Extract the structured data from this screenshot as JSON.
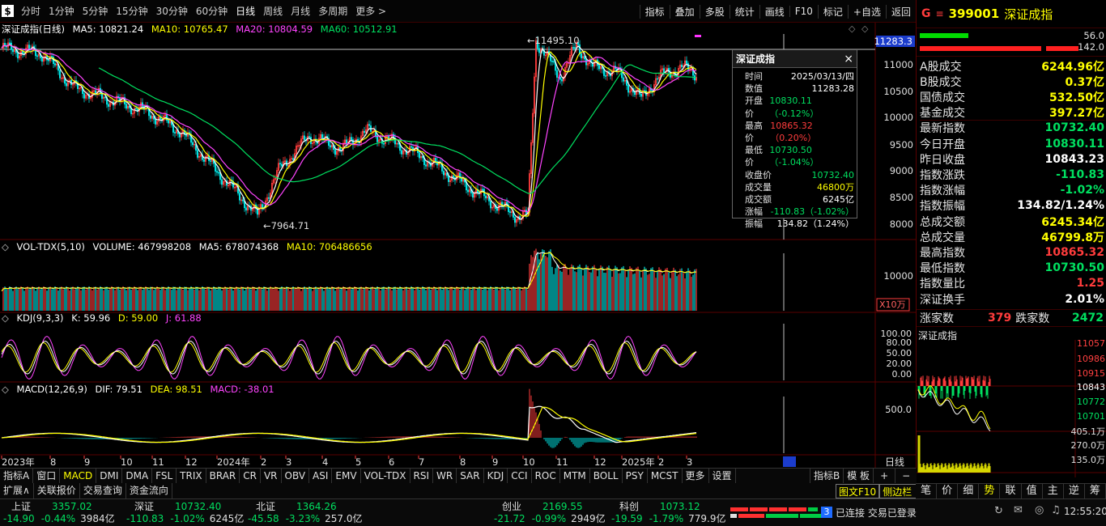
{
  "toolbar": {
    "logo": "$",
    "periods": [
      "分时",
      "1分钟",
      "5分钟",
      "15分钟",
      "30分钟",
      "60分钟",
      "日线",
      "周线",
      "月线",
      "多周期",
      "更多 >"
    ],
    "active_period": "日线",
    "right_items": [
      "指标",
      "叠加",
      "多股",
      "统计",
      "画线",
      "F10",
      "标记",
      "+自选",
      "返回"
    ]
  },
  "stock": {
    "g_label": "G",
    "menu": "≡",
    "code": "399001",
    "name": "深证成指"
  },
  "main_legend": {
    "title": "深证成指(日线)",
    "ma5": "MA5: 10821.24",
    "ma10": "MA10: 10765.47",
    "ma20": "MA20: 10804.59",
    "ma60": "MA60: 10512.91"
  },
  "price_axis": [
    "11000",
    "10500",
    "10000",
    "9500",
    "9000",
    "8500",
    "8000"
  ],
  "current_price_tag": "11283.3",
  "high_label": "11495.10",
  "low_label": "7964.71",
  "popup": {
    "title": "深证成指",
    "close": "×",
    "rows": [
      {
        "k": "时间",
        "v": "2025/03/13/四",
        "c": "white"
      },
      {
        "k": "数值",
        "v": "11283.28",
        "c": "white"
      },
      {
        "k": "开盘价",
        "v": "10830.11（-0.12%）",
        "c": "green"
      },
      {
        "k": "最高价",
        "v": "10865.32（0.20%）",
        "c": "red"
      },
      {
        "k": "最低价",
        "v": "10730.50（-1.04%）",
        "c": "green"
      },
      {
        "k": "收盘价",
        "v": "10732.40",
        "c": "green"
      },
      {
        "k": "成交量",
        "v": "46800万",
        "c": "yellow"
      },
      {
        "k": "成交额",
        "v": "6245亿",
        "c": "white"
      },
      {
        "k": "涨幅",
        "v": "-110.83（-1.02%）",
        "c": "green"
      },
      {
        "k": "振幅",
        "v": "134.82（1.24%）",
        "c": "white"
      }
    ]
  },
  "vol_legend": {
    "title": "VOL-TDX(5,10)",
    "volume": "VOLUME: 467998208",
    "ma5": "MA5: 678074368",
    "ma10": "MA10: 706486656"
  },
  "vol_axis": "10000",
  "vol_unit": "X10万",
  "kdj_legend": {
    "title": "KDJ(9,3,3)",
    "k": "K: 59.96",
    "d": "D: 59.00",
    "j": "J: 61.88"
  },
  "kdj_axis": [
    "100.00",
    "80.00",
    "50.00",
    "20.00",
    "0.00"
  ],
  "macd_legend": {
    "title": "MACD(12,26,9)",
    "dif": "DIF: 79.51",
    "dea": "DEA: 98.51",
    "macd": "MACD: -38.01"
  },
  "macd_axis": "500.0",
  "date_axis": [
    "2023年",
    "8",
    "9",
    "10",
    "11",
    "12",
    "2024年",
    "2",
    "3",
    "4",
    "5",
    "6",
    "7",
    "8",
    "9",
    "10",
    "11",
    "12",
    "2025年",
    "2",
    "3"
  ],
  "date_axis_right": "日线",
  "right_stats_top": {
    "up_count": "56.0",
    "down_count": "142.0",
    "up_color": "#00dd00",
    "down_color": "#ff2020"
  },
  "right_stats": [
    {
      "k": "A股成交",
      "v": "6244.96亿",
      "c": "yellow"
    },
    {
      "k": "B股成交",
      "v": "0.37亿",
      "c": "yellow"
    },
    {
      "k": "国债成交",
      "v": "532.50亿",
      "c": "yellow"
    },
    {
      "k": "基金成交",
      "v": "397.27亿",
      "c": "yellow"
    },
    {
      "k": "最新指数",
      "v": "10732.40",
      "c": "green"
    },
    {
      "k": "今日开盘",
      "v": "10830.11",
      "c": "green"
    },
    {
      "k": "昨日收盘",
      "v": "10843.23",
      "c": "white"
    },
    {
      "k": "指数涨跌",
      "v": "-110.83",
      "c": "green"
    },
    {
      "k": "指数涨幅",
      "v": "-1.02%",
      "c": "green"
    },
    {
      "k": "指数振幅",
      "v": "134.82/1.24%",
      "c": "white"
    },
    {
      "k": "总成交额",
      "v": "6245.34亿",
      "c": "yellow"
    },
    {
      "k": "总成交量",
      "v": "46799.8万",
      "c": "yellow"
    },
    {
      "k": "最高指数",
      "v": "10865.32",
      "c": "red"
    },
    {
      "k": "最低指数",
      "v": "10730.50",
      "c": "green"
    },
    {
      "k": "指数量比",
      "v": "1.25",
      "c": "red"
    },
    {
      "k": "深证换手",
      "v": "2.01%",
      "c": "white"
    }
  ],
  "breadth": {
    "up_label": "涨家数",
    "up": "379",
    "down_label": "跌家数",
    "down": "2472"
  },
  "mini_chart": {
    "title": "深证成指",
    "axis": [
      "11057",
      "10986",
      "10915",
      "10843",
      "10772",
      "10701",
      "405.1万",
      "270.0万",
      "135.0万"
    ]
  },
  "bottom_tabs": [
    "指标A",
    "窗口",
    "MACD",
    "DMI",
    "DMA",
    "FSL",
    "TRIX",
    "BRAR",
    "CR",
    "VR",
    "OBV",
    "ASI",
    "EMV",
    "VOL-TDX",
    "RSI",
    "WR",
    "SAR",
    "KDJ",
    "CCI",
    "ROC",
    "MTM",
    "BOLL",
    "PSY",
    "MCST",
    "更多",
    "设置"
  ],
  "bottom_tabs_selected": "MACD",
  "bottom_tabs_right": [
    "指标B",
    "模 板",
    "+",
    "−"
  ],
  "second_tabs": [
    "扩展∧",
    "关联报价",
    "交易查询",
    "资金流向"
  ],
  "second_tabs_right": [
    "图文F10",
    "侧边栏《"
  ],
  "right_tabs": [
    "笔",
    "价",
    "细",
    "势",
    "联",
    "值",
    "主",
    "逆",
    "筹"
  ],
  "right_tabs_selected": "势",
  "status": {
    "indices": [
      {
        "name": "上证",
        "value": "3357.02",
        "chg": "-14.90",
        "pct": "-0.44%",
        "amt": "3984亿"
      },
      {
        "name": "深证",
        "value": "10732.40",
        "chg": "-110.83",
        "pct": "-1.02%",
        "amt": "6245亿"
      },
      {
        "name": "北证",
        "value": "1364.26",
        "chg": "-45.58",
        "pct": "-3.23%",
        "amt": "257.0亿"
      },
      {
        "name": "创业",
        "value": "2169.55",
        "chg": "-21.72",
        "pct": "-0.99%",
        "amt": "2949亿"
      },
      {
        "name": "科创",
        "value": "1073.12",
        "chg": "-19.59",
        "pct": "-1.79%",
        "amt": "779.9亿"
      }
    ],
    "conn_badge": "3",
    "conn_text": "已连接 交易已登录",
    "time": "12:55:20"
  }
}
